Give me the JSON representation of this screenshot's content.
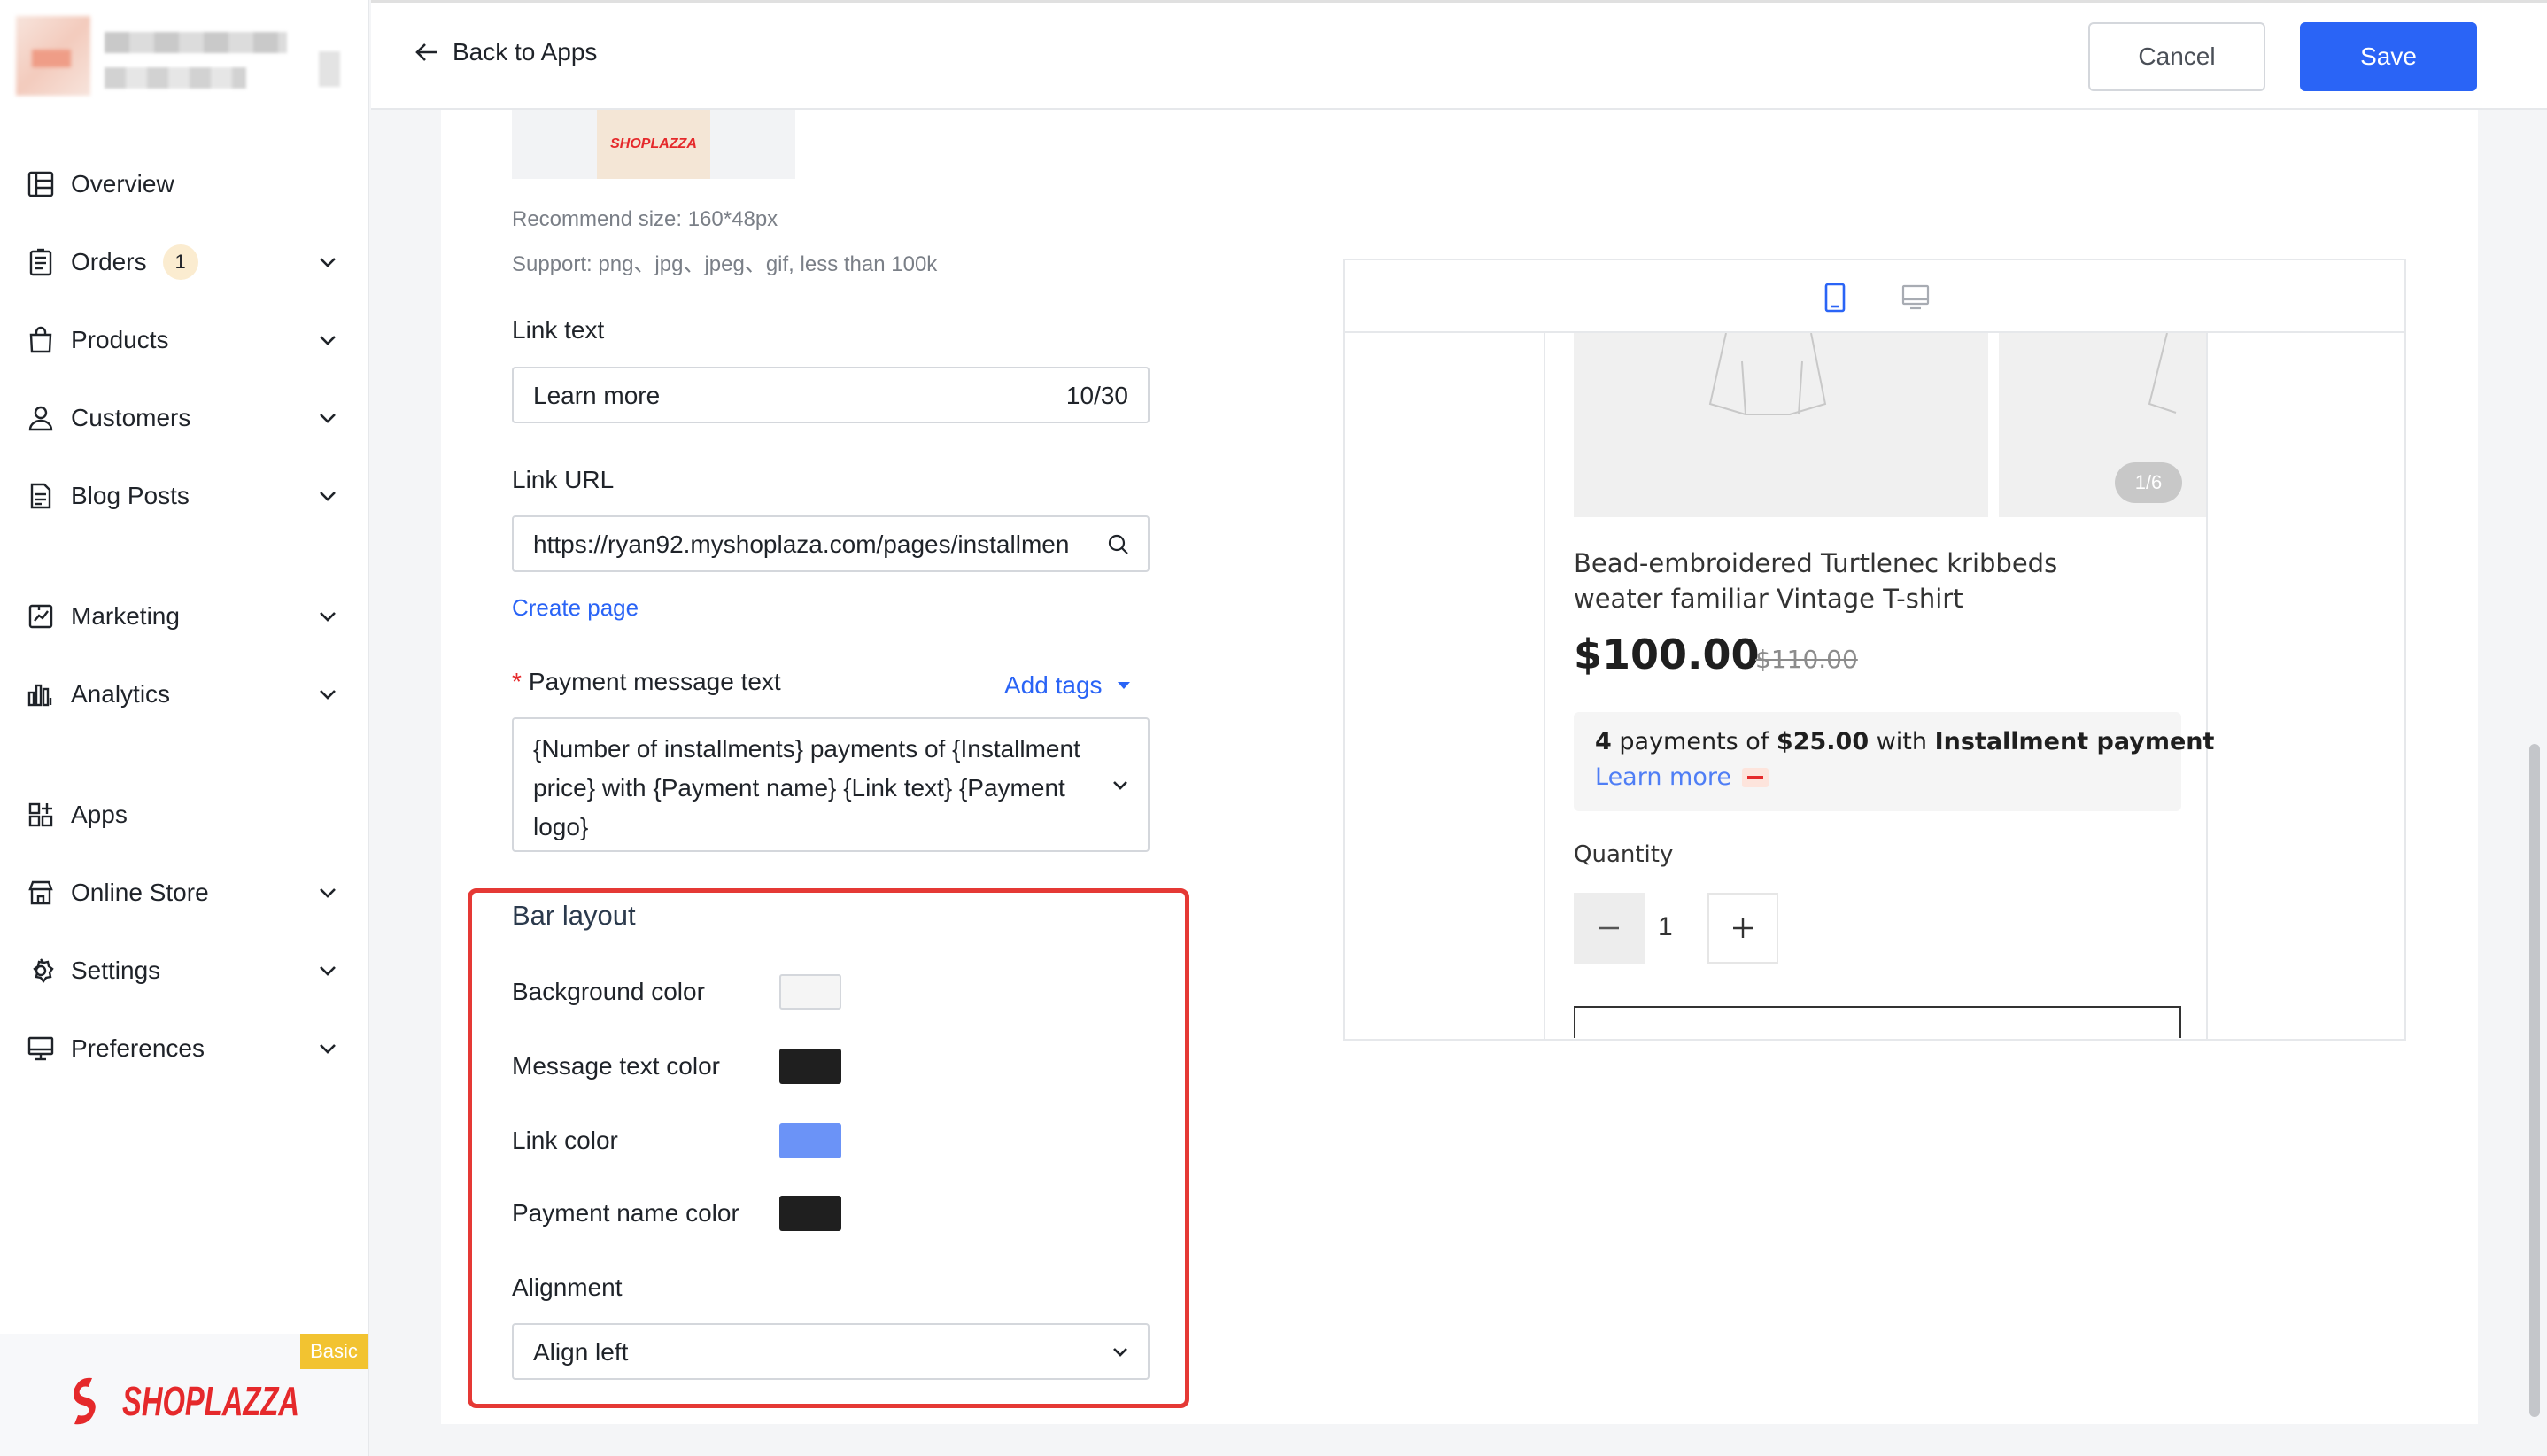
{
  "sidebar": {
    "items": [
      {
        "label": "Overview",
        "icon": "overview-icon"
      },
      {
        "label": "Orders",
        "icon": "orders-icon",
        "badge": "1"
      },
      {
        "label": "Products",
        "icon": "products-icon"
      },
      {
        "label": "Customers",
        "icon": "customers-icon"
      },
      {
        "label": "Blog Posts",
        "icon": "blog-icon"
      },
      {
        "label": "Marketing",
        "icon": "marketing-icon"
      },
      {
        "label": "Analytics",
        "icon": "analytics-icon"
      },
      {
        "label": "Apps",
        "icon": "apps-icon"
      },
      {
        "label": "Online Store",
        "icon": "store-icon"
      },
      {
        "label": "Settings",
        "icon": "gear-icon"
      },
      {
        "label": "Preferences",
        "icon": "monitor-icon"
      }
    ],
    "plan_badge": "Basic",
    "brand": "SHOPLAZZA"
  },
  "header": {
    "back_label": "Back to Apps",
    "cancel_label": "Cancel",
    "save_label": "Save"
  },
  "form": {
    "logo_text": "SHOPLAZZA",
    "recommend_size": "Recommend size: 160*48px",
    "support": "Support: png、jpg、jpeg、gif, less than 100k",
    "link_text_label": "Link text",
    "link_text_value": "Learn more",
    "link_text_count": "10/30",
    "link_url_label": "Link URL",
    "link_url_value": "https://ryan92.myshoplaza.com/pages/installmen",
    "create_page": "Create page",
    "payment_msg_label": "Payment message text",
    "add_tags": "Add tags",
    "payment_msg_value": "{Number of installments} payments of {Installment price} with {Payment name} {Link text} {Payment logo}",
    "bar_layout": {
      "title": "Bar layout",
      "background_color_label": "Background color",
      "background_color": "#f5f5f5",
      "message_text_color_label": "Message text color",
      "message_text_color": "#1f1f1f",
      "link_color_label": "Link color",
      "link_color": "#6b93f7",
      "payment_name_color_label": "Payment name color",
      "payment_name_color": "#1f1f1f",
      "alignment_label": "Alignment",
      "alignment_value": "Align left"
    }
  },
  "preview": {
    "pager": "1/6",
    "product_title": "Bead-embroidered Turtlenec kribbeds weater familiar Vintage T-shirt",
    "price": "$100.00",
    "original_price": "$110.00",
    "bar_count": "4",
    "bar_text1": " payments of ",
    "bar_price": "$25.00",
    "bar_text2": " with ",
    "bar_name": "Installment payment",
    "bar_link": "Learn more",
    "quantity_label": "Quantity",
    "quantity_value": "1"
  }
}
